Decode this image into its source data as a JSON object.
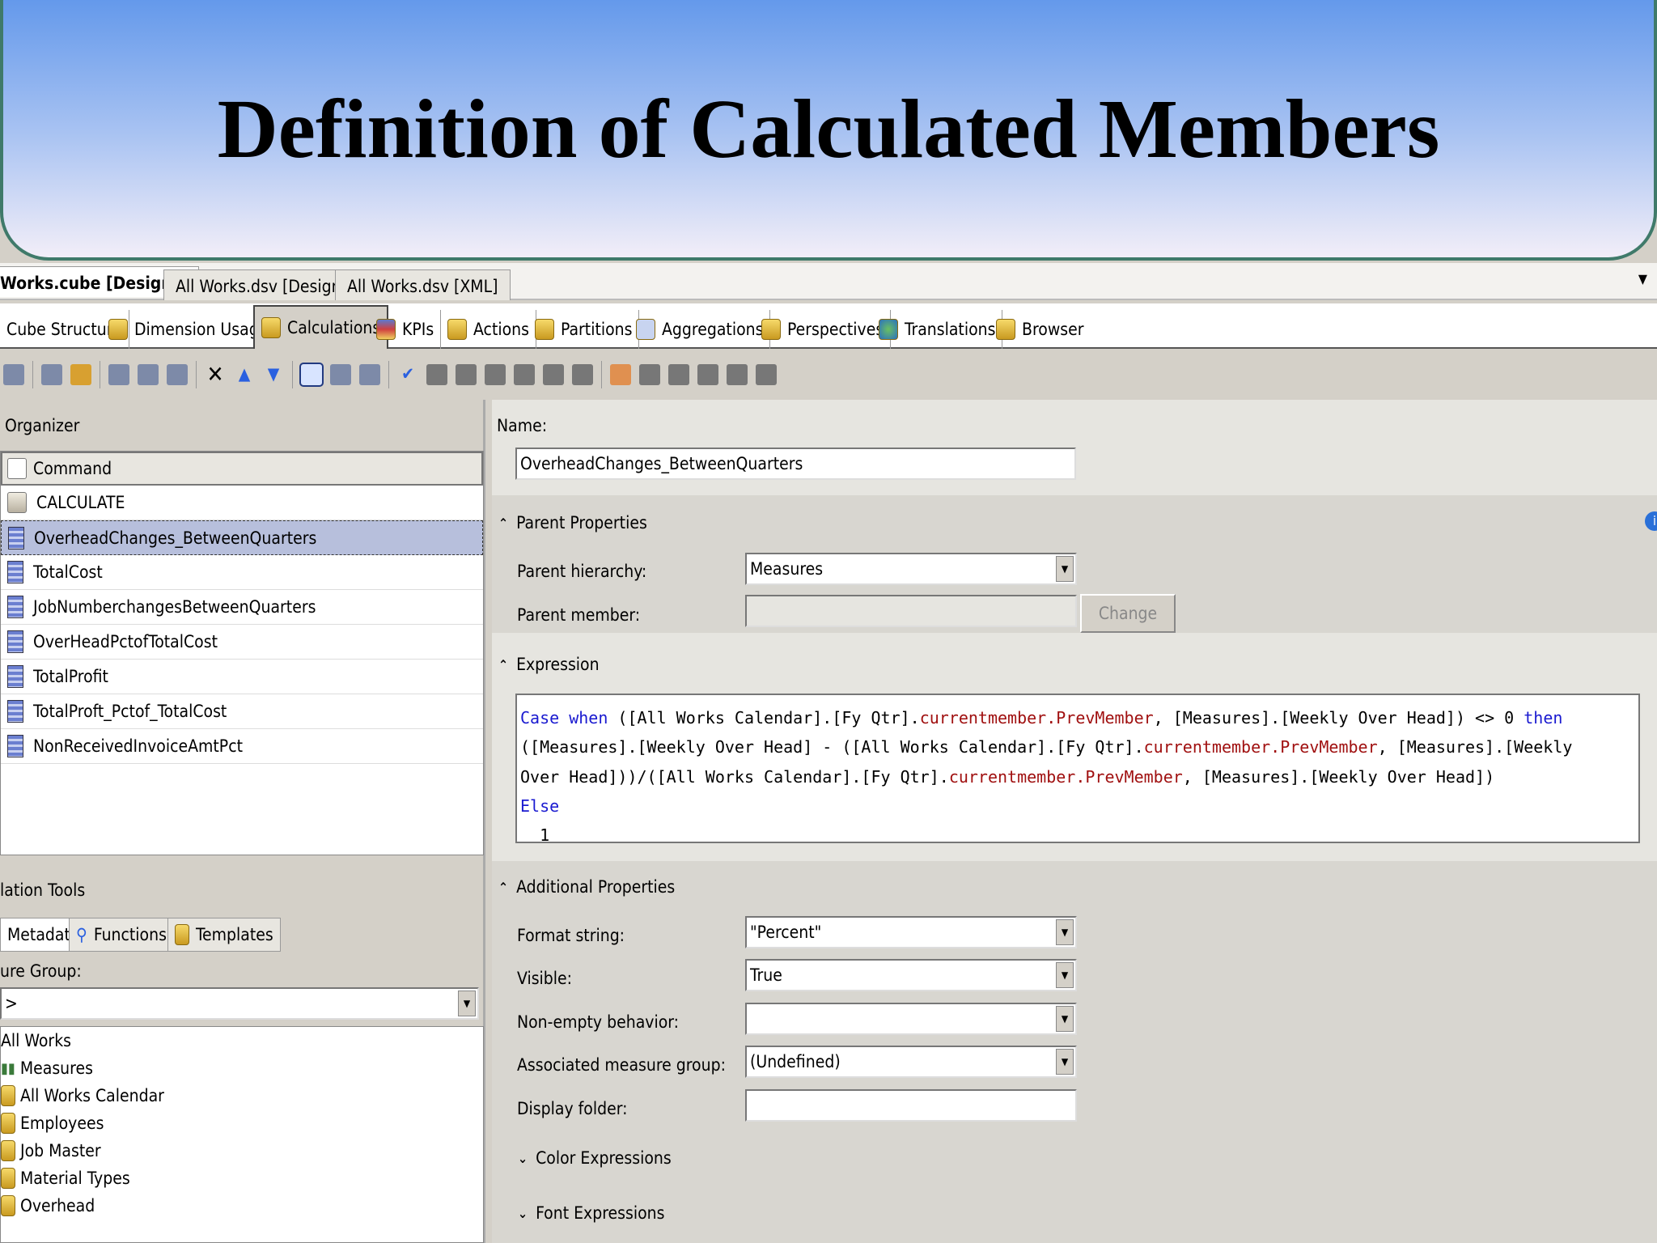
{
  "slide": {
    "title": "Definition of Calculated Members"
  },
  "doc_tabs": [
    "Works.cube [Design]*",
    "All Works.dsv [Design]",
    "All Works.dsv [XML]"
  ],
  "designer_tabs": [
    "Cube Structure",
    "Dimension Usage",
    "Calculations",
    "KPIs",
    "Actions",
    "Partitions",
    "Aggregations",
    "Perspectives",
    "Translations",
    "Browser"
  ],
  "organizer": {
    "label": "Organizer",
    "column": "Command",
    "items": [
      "CALCULATE",
      "OverheadChanges_BetweenQuarters",
      "TotalCost",
      "JobNumberchangesBetweenQuarters",
      "OverHeadPctofTotalCost",
      "TotalProfit",
      "TotalProft_Pctof_TotalCost",
      "NonReceivedInvoiceAmtPct"
    ]
  },
  "tools": {
    "label": "lation Tools",
    "tabs": [
      "Metadata",
      "Functions",
      "Templates"
    ],
    "group_label": "ure Group:",
    "group_value": ">",
    "tree": [
      "All Works",
      "Measures",
      "All Works Calendar",
      "Employees",
      "Job Master",
      "Material Types",
      "Overhead"
    ]
  },
  "form": {
    "name_label": "Name:",
    "name_value": "OverheadChanges_BetweenQuarters",
    "parent_section": "Parent Properties",
    "parent_hierarchy_label": "Parent hierarchy:",
    "parent_hierarchy_value": "Measures",
    "parent_member_label": "Parent member:",
    "change_label": "Change",
    "expression_section": "Expression",
    "expr": {
      "l1a": "Case when",
      "l1b": " ([All Works Calendar].[Fy Qtr].",
      "l1c": "currentmember.PrevMember",
      "l1d": ", [Measures].[Weekly Over Head]) <> 0 ",
      "l1e": "then",
      "l2a": "([Measures].[Weekly Over Head] - ([All Works Calendar].[Fy Qtr].",
      "l2b": "currentmember.PrevMember",
      "l2c": ", [Measures].[Weekly",
      "l3a": "Over Head]))/([All Works Calendar].[Fy Qtr].",
      "l3b": "currentmember.PrevMember",
      "l3c": ", [Measures].[Weekly Over Head])",
      "l4": "Else",
      "l5": "  1"
    },
    "additional_section": "Additional Properties",
    "format_label": "Format string:",
    "format_value": "\"Percent\"",
    "visible_label": "Visible:",
    "visible_value": "True",
    "nonempty_label": "Non-empty behavior:",
    "nonempty_value": "",
    "assoc_label": "Associated measure group:",
    "assoc_value": "(Undefined)",
    "folder_label": "Display folder:",
    "folder_value": "",
    "color_section": "Color Expressions",
    "font_section": "Font Expressions"
  },
  "colors": {
    "keyword": "#1a1ad0",
    "function": "#a01010",
    "selection": "#b7bfdc"
  }
}
